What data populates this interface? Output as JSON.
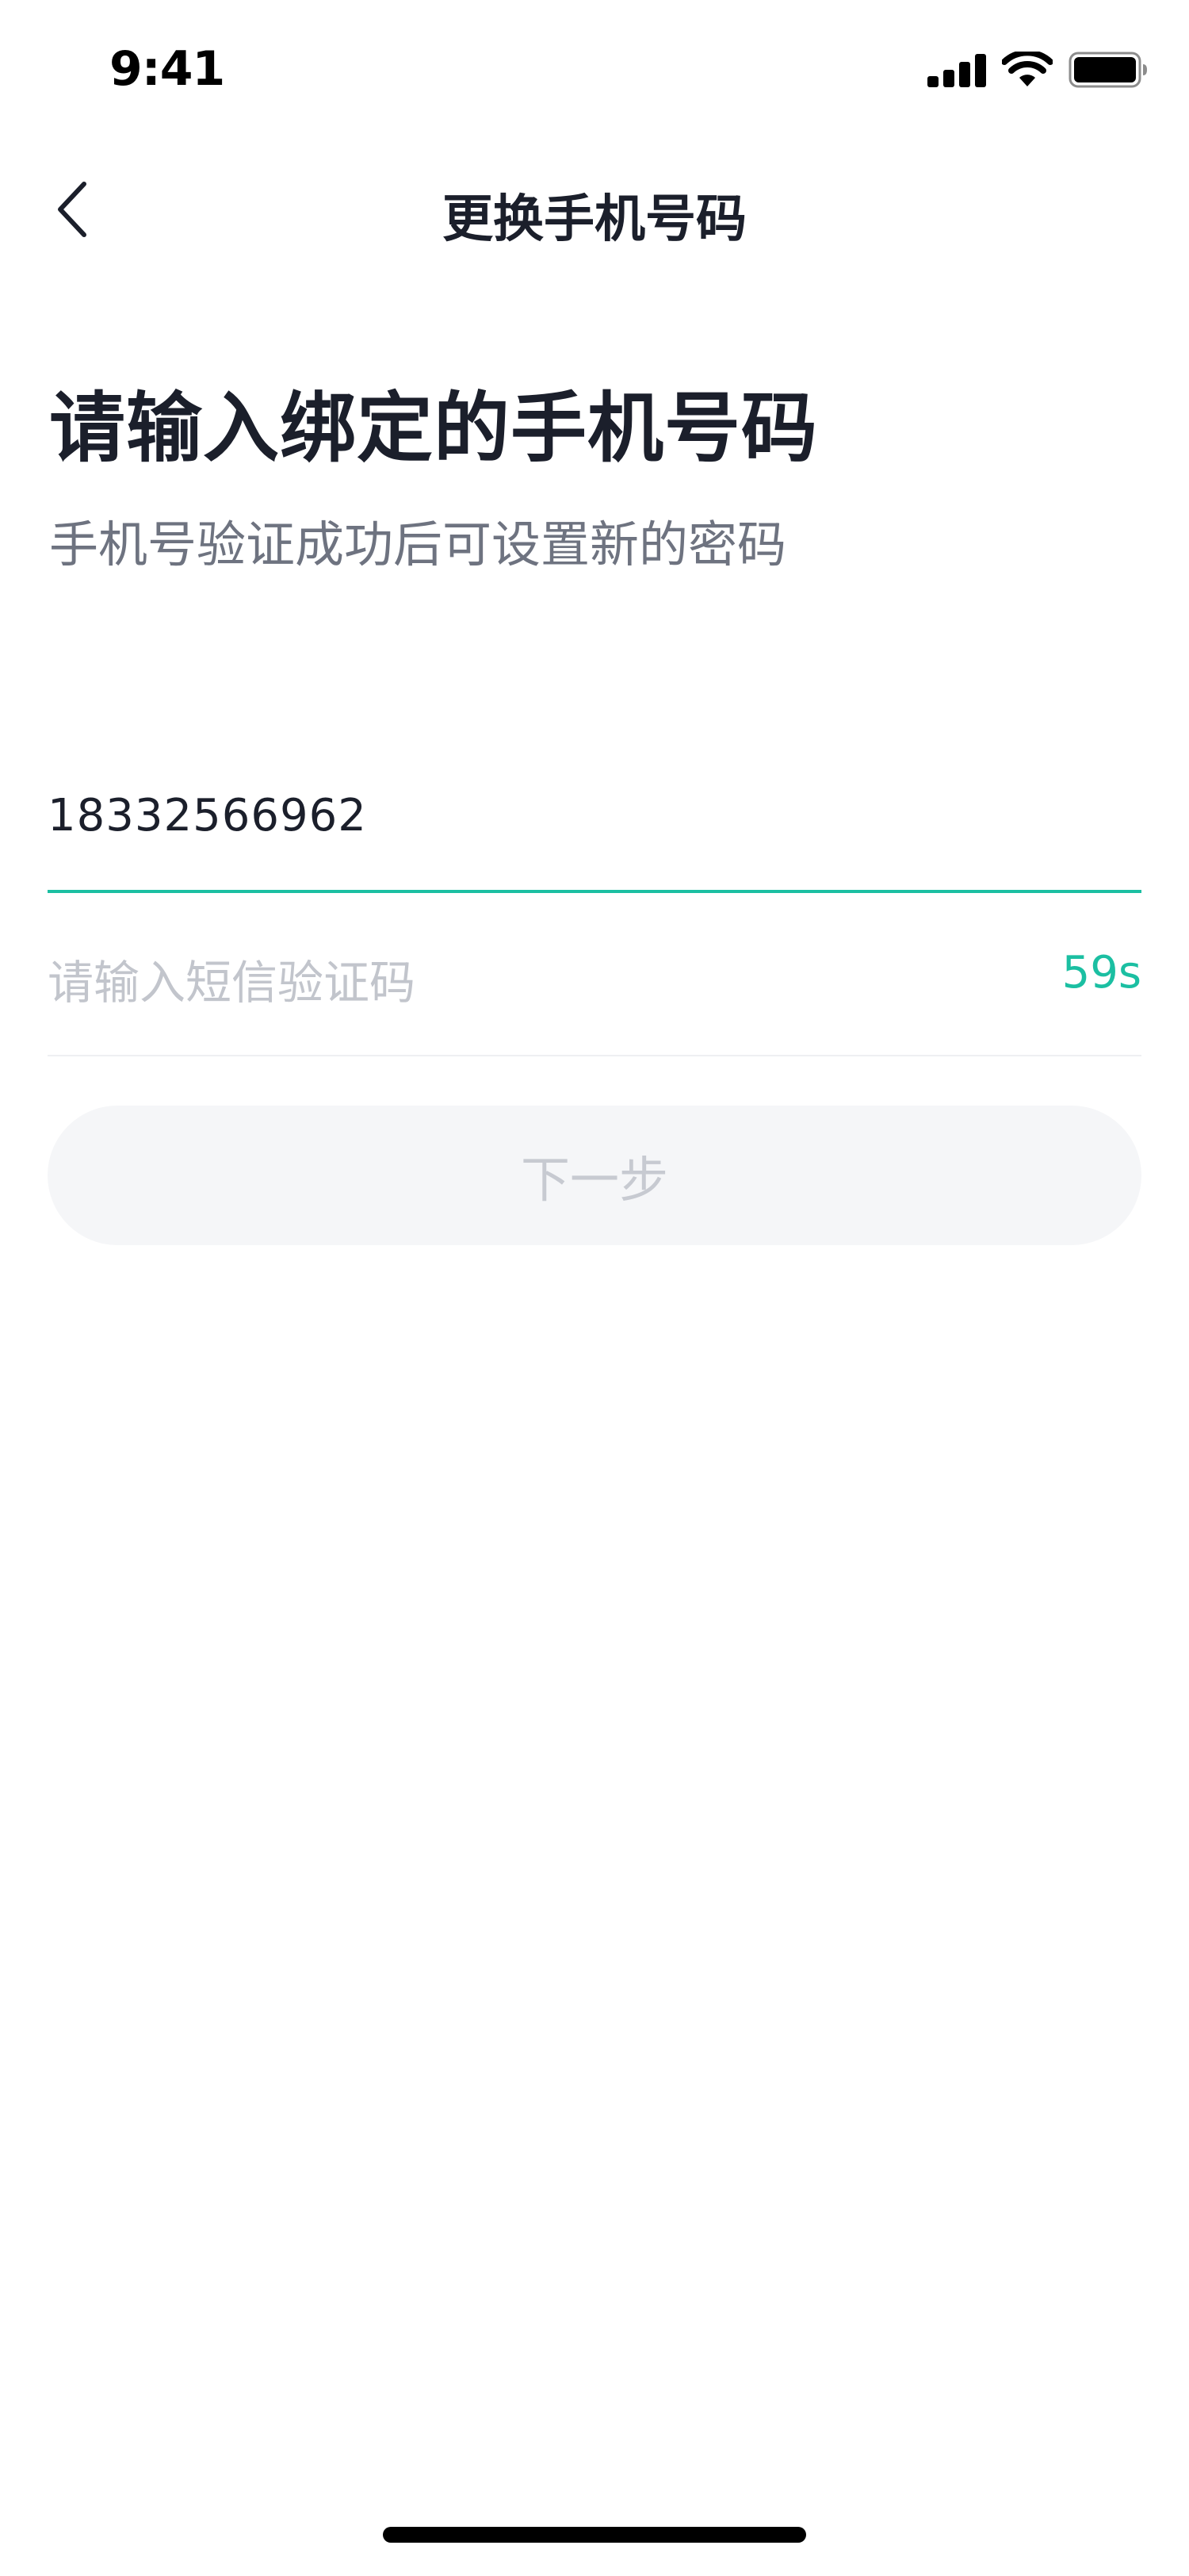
{
  "status_bar": {
    "time": "9:41",
    "icons": [
      "signal-icon",
      "wifi-icon",
      "battery-icon"
    ]
  },
  "nav": {
    "back_icon": "chevron-left-icon",
    "title": "更换手机号码"
  },
  "heading": {
    "title": "请输入绑定的手机号码",
    "subtitle": "手机号验证成功后可设置新的密码"
  },
  "form": {
    "phone_value": "18332566962",
    "code_placeholder": "请输入短信验证码",
    "countdown": "59s",
    "next_label": "下一步"
  },
  "colors": {
    "accent": "#1bbfa2",
    "text_primary": "#1b1f2b",
    "text_secondary": "#6e7380",
    "placeholder": "#c2c5cc",
    "button_disabled_bg": "#f5f6f8",
    "button_disabled_text": "#c7cad1"
  }
}
